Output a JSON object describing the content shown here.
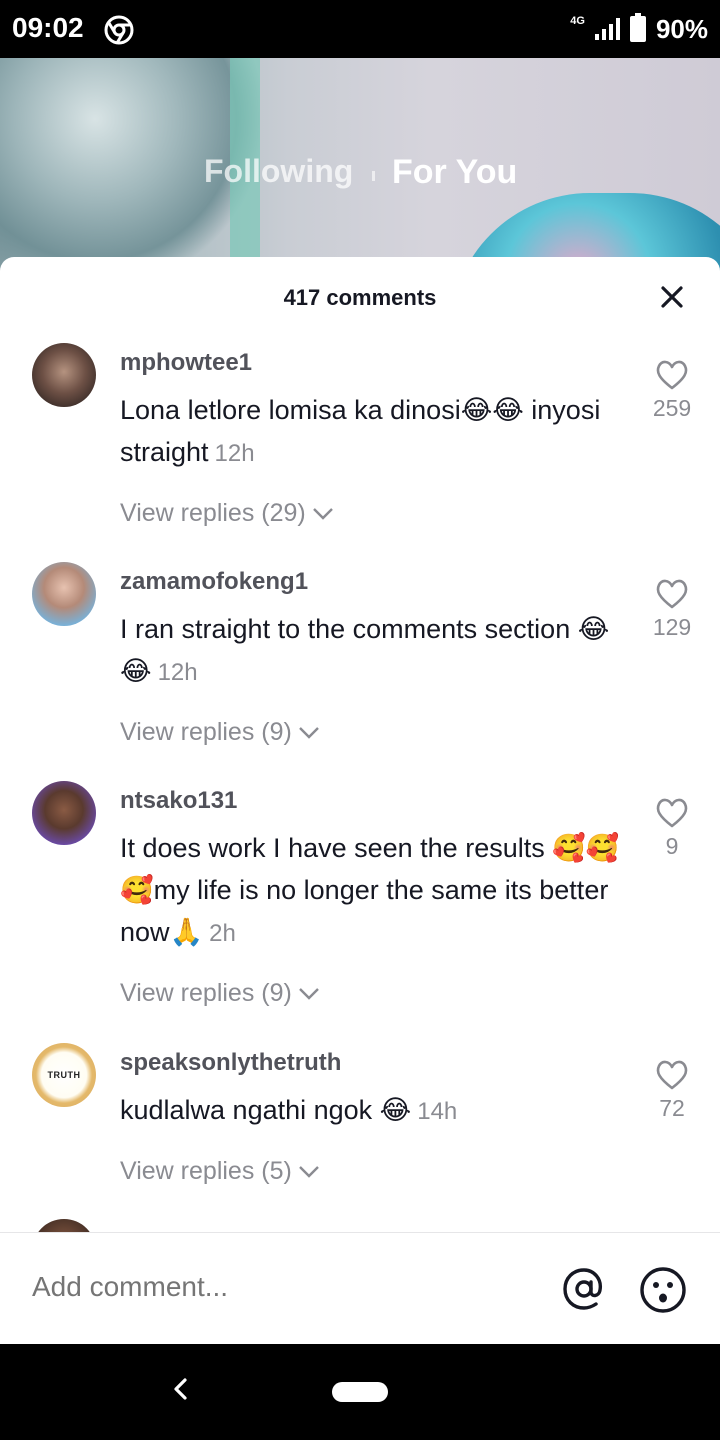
{
  "status_bar": {
    "time": "09:02",
    "network": "4G",
    "battery": "90%"
  },
  "feed_tabs": {
    "following": "Following",
    "for_you": "For You"
  },
  "comments_sheet": {
    "title": "417 comments",
    "comments": [
      {
        "username": "mphowtee1",
        "text": "Lona letlore lomisa ka dinosi😂😂 inyosi straight",
        "time": "12h",
        "likes": "259",
        "replies_label": "View replies (29)"
      },
      {
        "username": "zamamofokeng1",
        "text": "I ran straight to the comments section 😂😂",
        "time": "12h",
        "likes": "129",
        "replies_label": "View replies (9)"
      },
      {
        "username": "ntsako131",
        "text": "It does work I have seen the results 🥰🥰🥰my life is no longer the same its better now🙏",
        "time": "2h",
        "likes": "9",
        "replies_label": "View replies (9)"
      },
      {
        "username": "speaksonlythetruth",
        "avatar_text": "TRUTH",
        "text": "kudlalwa ngathi ngok 😂",
        "time": "14h",
        "likes": "72",
        "replies_label": "View replies (5)"
      }
    ],
    "input_placeholder": "Add comment..."
  },
  "icons": {
    "close": "close-icon",
    "like": "heart-icon",
    "mention": "at-sign-icon",
    "emoji": "smiley-icon",
    "back": "back-chevron-icon"
  },
  "colors": {
    "text_primary": "#161823",
    "text_secondary": "#8a8b91"
  }
}
